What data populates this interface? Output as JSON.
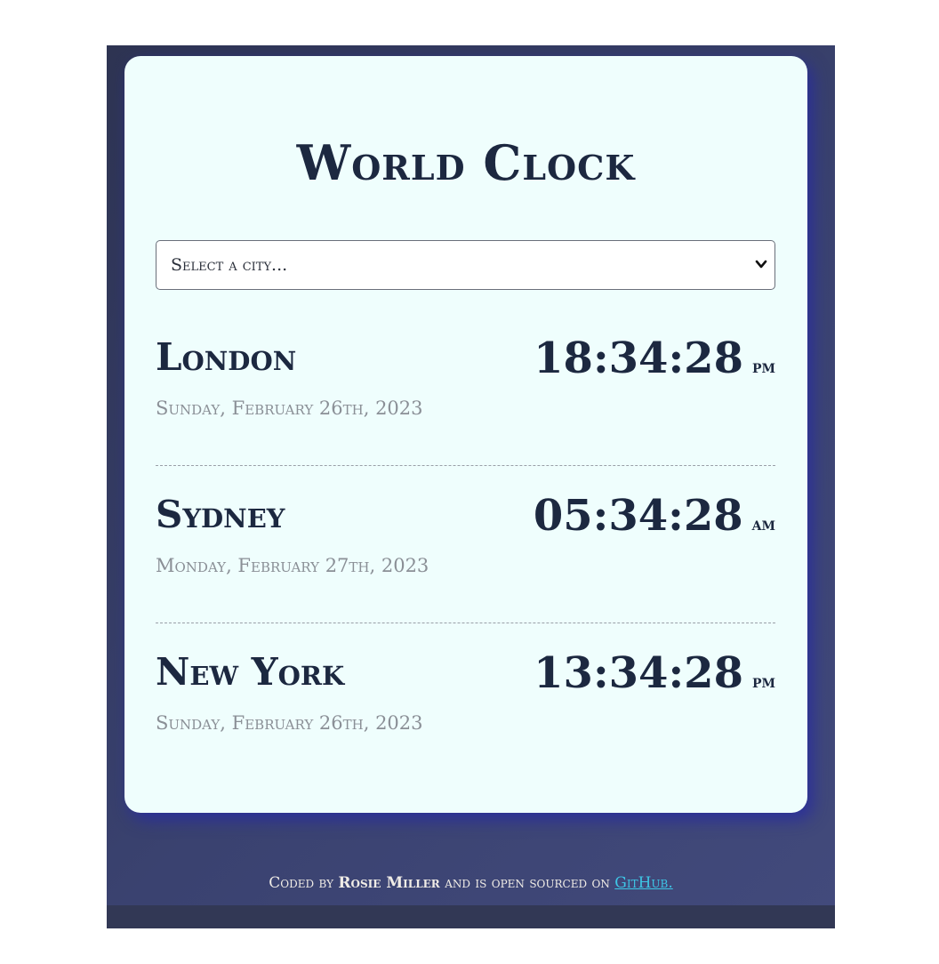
{
  "app": {
    "title": "World Clock"
  },
  "city_select": {
    "value": "Select a city..."
  },
  "cities": [
    {
      "name": "London",
      "date": "Sunday, February 26th, 2023",
      "time": "18:34:28",
      "ampm": "PM"
    },
    {
      "name": "Sydney",
      "date": "Monday, February 27th, 2023",
      "time": "05:34:28",
      "ampm": "AM"
    },
    {
      "name": "New York",
      "date": "Sunday, February 26th, 2023",
      "time": "13:34:28",
      "ampm": "PM"
    }
  ],
  "footer": {
    "prefix": "Coded by",
    "author": "Rosie Miller",
    "middle": "and is open sourced on",
    "link_text": "GitHub."
  },
  "colors": {
    "card_background": "#effefd",
    "frame_background": "#3a4270",
    "heading_text": "#1c2840",
    "date_text": "#8a8f96",
    "link": "#3ec6e6",
    "card_shadow": "#2828a0"
  },
  "icons": {
    "select_arrow": "chevron-down-icon"
  }
}
